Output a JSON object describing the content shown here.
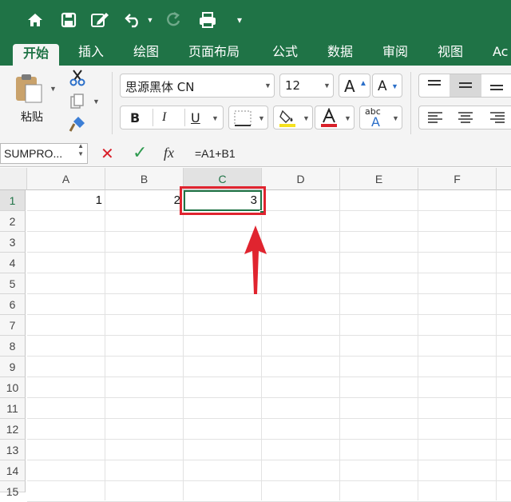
{
  "quick_access": {
    "home_icon": "home-icon",
    "save_icon": "save-icon",
    "edit_icon": "edit-icon",
    "undo_icon": "undo-icon",
    "redo_icon": "redo-icon",
    "print_icon": "print-icon",
    "customize_icon": "customize-caret-icon"
  },
  "tabs": [
    "开始",
    "插入",
    "绘图",
    "页面布局",
    "公式",
    "数据",
    "审阅",
    "视图",
    "Ac"
  ],
  "ribbon": {
    "paste_label": "粘贴",
    "font_name": "思源黑体 CN",
    "font_size": "12",
    "bold": "B",
    "italic": "I",
    "underline": "U",
    "increase_font": "A",
    "decrease_font": "A",
    "phonetic_top": "abc",
    "phonetic_bottom": "A",
    "fill_color": "#f5e11f",
    "font_color": "#d9202a"
  },
  "formula_bar": {
    "name_box": "SUMPRO...",
    "cancel_icon": "✕",
    "enter_icon": "✓",
    "fx_label": "fx",
    "formula": "=A1+B1"
  },
  "sheet": {
    "columns": [
      "A",
      "B",
      "C",
      "D",
      "E",
      "F"
    ],
    "rows": [
      "1",
      "2",
      "3",
      "4",
      "5",
      "6",
      "7",
      "8",
      "9",
      "10",
      "11",
      "12",
      "13",
      "14",
      "15"
    ],
    "cells": {
      "A1": "1",
      "B1": "2",
      "C1": "3"
    },
    "active_cell": "C1"
  },
  "annotation": {
    "color": "#e0242f"
  },
  "colors": {
    "brand": "#1f7346"
  }
}
